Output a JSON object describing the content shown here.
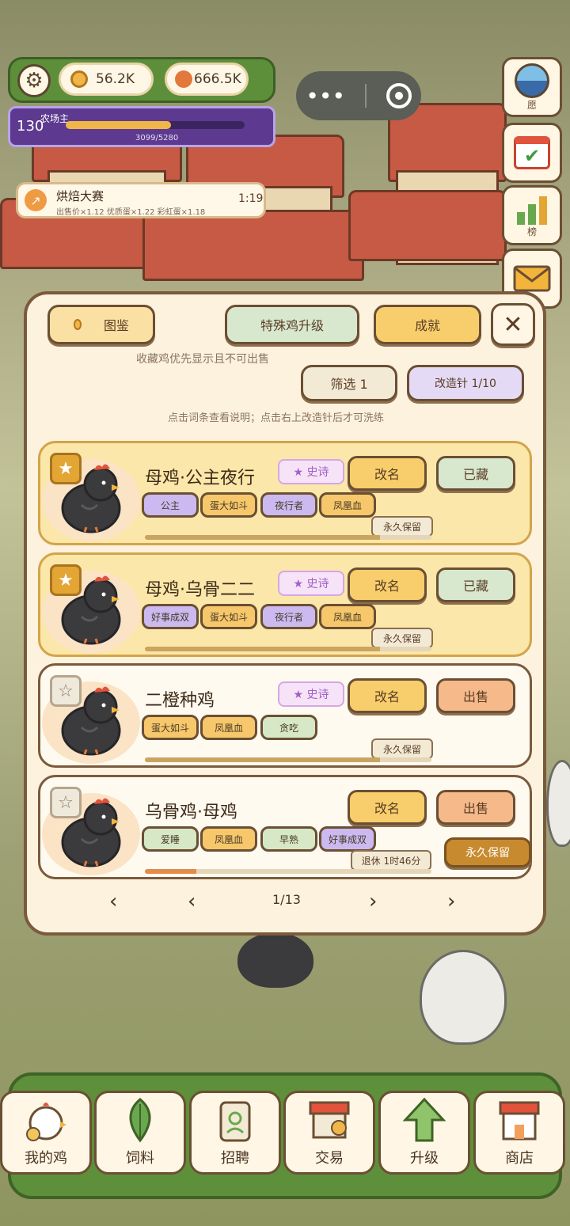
{
  "top_bar": {
    "coins": "56.2K",
    "gems": "666.5K",
    "level": "130",
    "title": "农场主",
    "xp": "3099/5280",
    "xp_fraction": 0.587
  },
  "side_buttons": [
    {
      "label": "愿",
      "icon": "globe-icon"
    },
    {
      "label": "",
      "icon": "calendar-check-icon"
    },
    {
      "label": "榜",
      "icon": "bar-chart-icon"
    },
    {
      "label": "",
      "icon": "mail-icon"
    }
  ],
  "event": {
    "title": "烘焙大赛",
    "desc": "出售价×1.12 优质蛋×1.22 彩虹蛋×1.18",
    "timer": "1:19"
  },
  "panel": {
    "tab_collection": "图鉴",
    "tab_special": "特殊鸡升级",
    "tab_achievement": "成就",
    "note_top": "收藏鸡优先显示且不可出售",
    "filter_label": "筛选 1",
    "reforge_label": "改造针 1/10",
    "note_bottom": "点击词条查看说明；点击右上改造针后才可洗练",
    "page": "1/13"
  },
  "cards": [
    {
      "name": "母鸡·公主夜行",
      "rarity": "★ 史诗",
      "starred": true,
      "rename": "改名",
      "action": "已藏",
      "keep": "永久保留",
      "progress": 0.82,
      "tags": [
        {
          "text": "公主",
          "style": "purple"
        },
        {
          "text": "蛋大如斗",
          "style": "orange"
        },
        {
          "text": "夜行者",
          "style": "purple"
        },
        {
          "text": "凤凰血",
          "style": "orange"
        }
      ]
    },
    {
      "name": "母鸡·乌骨二二",
      "rarity": "★ 史诗",
      "starred": true,
      "rename": "改名",
      "action": "已藏",
      "keep": "永久保留",
      "progress": 0.82,
      "tags": [
        {
          "text": "好事成双",
          "style": "purple"
        },
        {
          "text": "蛋大如斗",
          "style": "orange"
        },
        {
          "text": "夜行者",
          "style": "purple"
        },
        {
          "text": "凤凰血",
          "style": "orange"
        }
      ]
    },
    {
      "name": "二橙种鸡",
      "rarity": "★ 史诗",
      "starred": false,
      "rename": "改名",
      "action": "出售",
      "keep": "永久保留",
      "progress": 0.82,
      "tags": [
        {
          "text": "蛋大如斗",
          "style": "orange"
        },
        {
          "text": "凤凰血",
          "style": "orange"
        },
        {
          "text": "贪吃",
          "style": "green"
        }
      ]
    },
    {
      "name": "乌骨鸡·母鸡",
      "rarity": "",
      "starred": false,
      "rename": "改名",
      "action": "出售",
      "keep": "退休 1时46分",
      "keep_button": "永久保留",
      "progress": 0.18,
      "tags": [
        {
          "text": "爱睡",
          "style": "green"
        },
        {
          "text": "凤凰血",
          "style": "orange"
        },
        {
          "text": "早熟",
          "style": "green"
        },
        {
          "text": "好事成双",
          "style": "purple"
        }
      ]
    }
  ],
  "nav": [
    {
      "label": "我的鸡",
      "icon": "chicken-icon"
    },
    {
      "label": "饲料",
      "icon": "leaf-icon"
    },
    {
      "label": "招聘",
      "icon": "id-badge-icon"
    },
    {
      "label": "交易",
      "icon": "market-stall-icon"
    },
    {
      "label": "升级",
      "icon": "up-arrow-icon"
    },
    {
      "label": "商店",
      "icon": "shop-icon"
    }
  ],
  "colors": {
    "accent": "#5d8f3a",
    "gold": "#e3a533",
    "purple": "#5d3a8f"
  }
}
